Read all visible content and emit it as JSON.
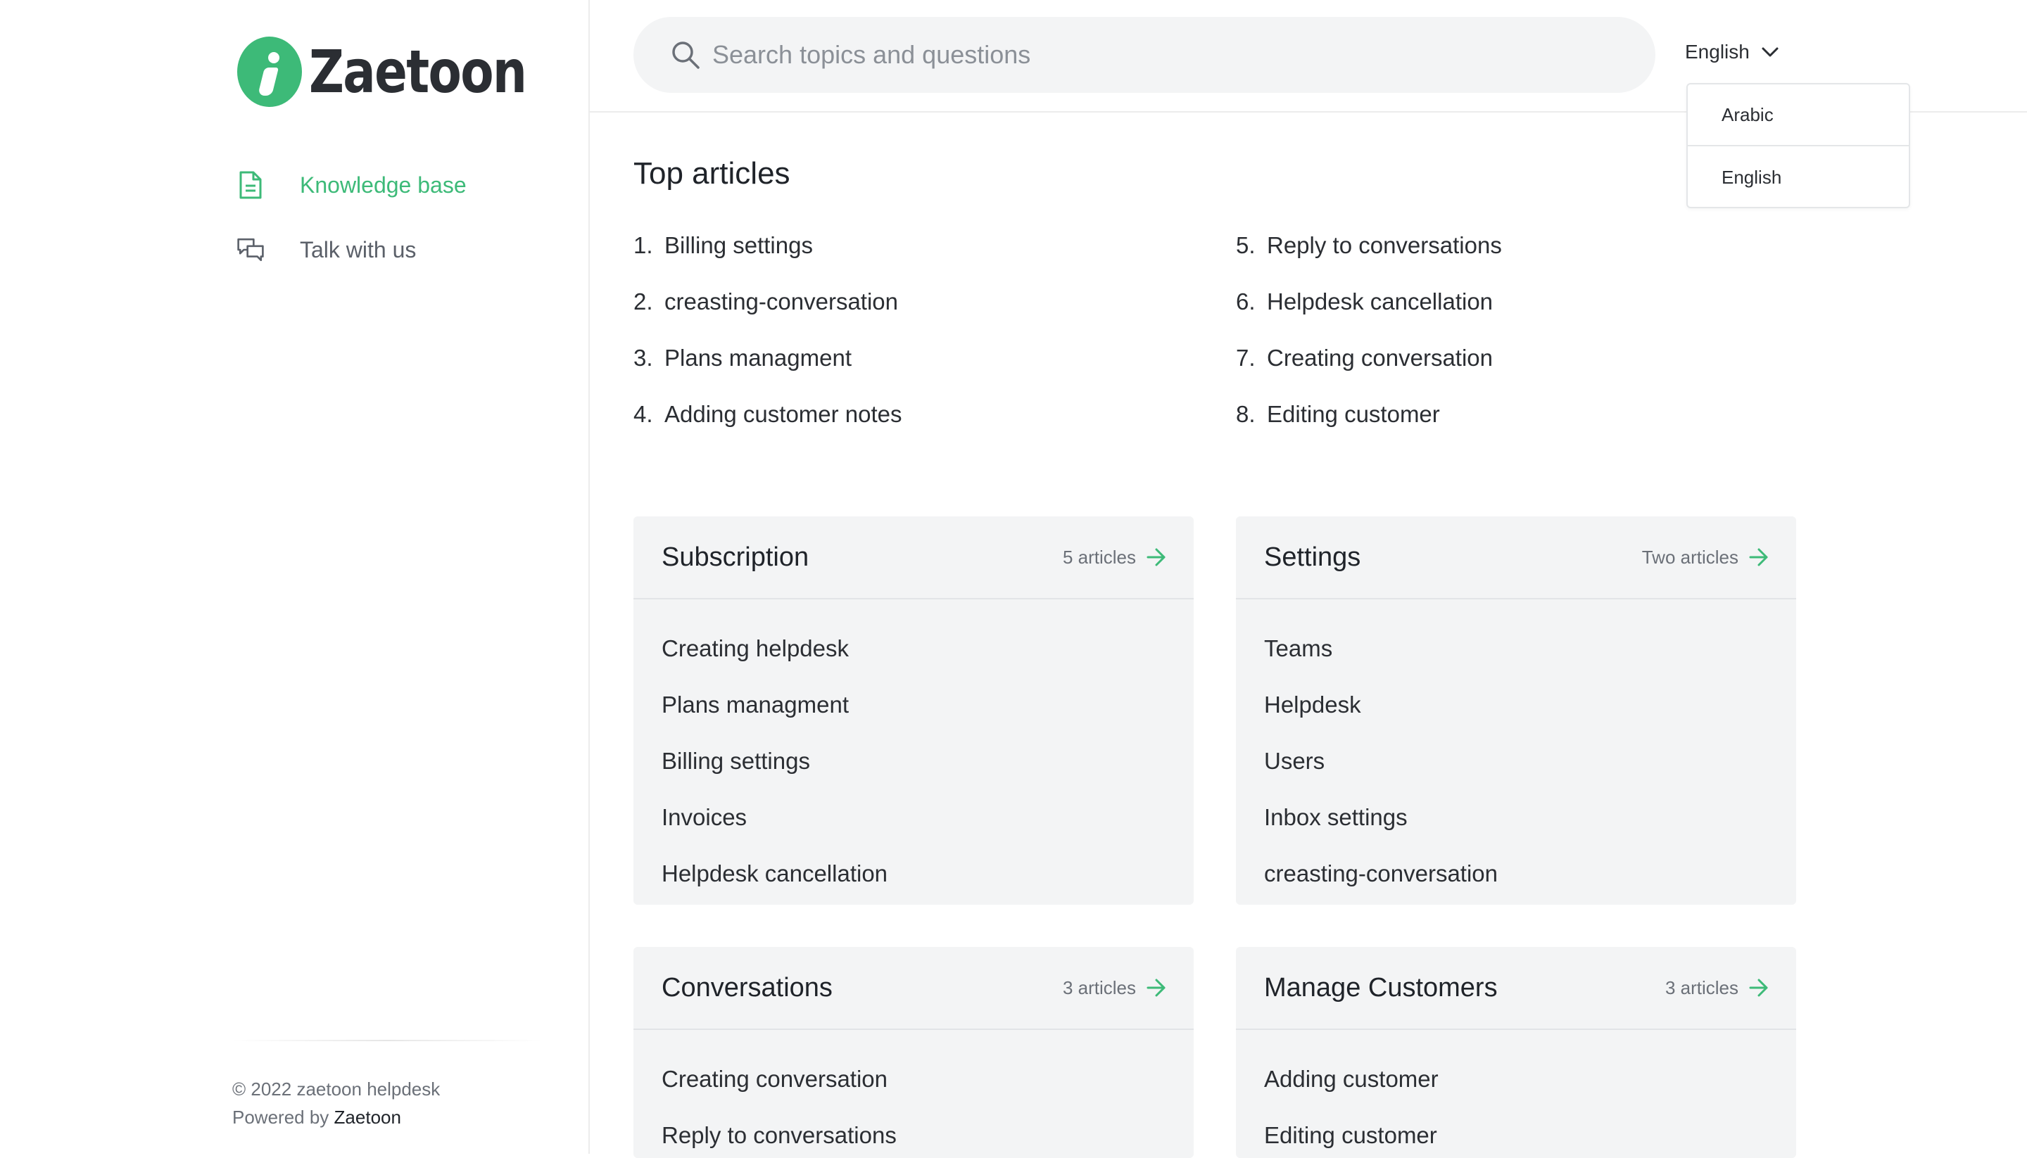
{
  "brand": {
    "name": "Zaetoon",
    "accent": "#3dba78"
  },
  "sidebar": {
    "items": [
      {
        "label": "Knowledge base",
        "icon": "document-icon",
        "active": true
      },
      {
        "label": "Talk with us",
        "icon": "chat-bubbles-icon",
        "active": false
      }
    ],
    "footer": {
      "copyright": "© 2022 zaetoon helpdesk",
      "powered_prefix": "Powered by",
      "powered_brand": "Zaetoon"
    }
  },
  "search": {
    "placeholder": "Search topics and questions",
    "value": ""
  },
  "language": {
    "selected": "English",
    "options": [
      "Arabic",
      "English"
    ]
  },
  "top_articles": {
    "title": "Top articles",
    "items": [
      {
        "n": "1.",
        "label": "Billing settings"
      },
      {
        "n": "2.",
        "label": "creasting-conversation"
      },
      {
        "n": "3.",
        "label": "Plans managment"
      },
      {
        "n": "4.",
        "label": "Adding customer notes"
      },
      {
        "n": "5.",
        "label": "Reply to conversations"
      },
      {
        "n": "6.",
        "label": "Helpdesk cancellation"
      },
      {
        "n": "7.",
        "label": "Creating conversation"
      },
      {
        "n": "8.",
        "label": "Editing customer"
      }
    ]
  },
  "categories": [
    {
      "title": "Subscription",
      "count": "5 articles",
      "articles": [
        "Creating helpdesk",
        "Plans managment",
        "Billing settings",
        "Invoices",
        "Helpdesk cancellation"
      ]
    },
    {
      "title": "Settings",
      "count": "Two articles",
      "articles": [
        "Teams",
        "Helpdesk",
        "Users",
        "Inbox settings",
        "creasting-conversation"
      ]
    },
    {
      "title": "Conversations",
      "count": "3 articles",
      "articles": [
        "Creating conversation",
        "Reply to conversations"
      ]
    },
    {
      "title": "Manage Customers",
      "count": "3 articles",
      "articles": [
        "Adding customer",
        "Editing customer"
      ]
    }
  ]
}
